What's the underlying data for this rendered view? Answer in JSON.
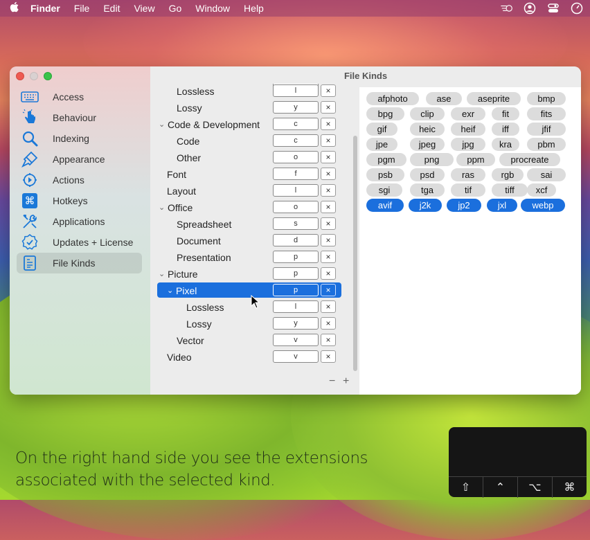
{
  "menubar": {
    "app_name": "Finder",
    "items": [
      "File",
      "Edit",
      "View",
      "Go",
      "Window",
      "Help"
    ]
  },
  "window": {
    "title": "File Kinds"
  },
  "sidebar": {
    "items": [
      {
        "label": "Access",
        "icon": "keyboard-icon"
      },
      {
        "label": "Behaviour",
        "icon": "hand-pointer-icon"
      },
      {
        "label": "Indexing",
        "icon": "magnifier-icon"
      },
      {
        "label": "Appearance",
        "icon": "brush-icon"
      },
      {
        "label": "Actions",
        "icon": "actions-icon"
      },
      {
        "label": "Hotkeys",
        "icon": "command-key-icon"
      },
      {
        "label": "Applications",
        "icon": "tools-icon"
      },
      {
        "label": "Updates + License",
        "icon": "badge-check-icon"
      },
      {
        "label": "File Kinds",
        "icon": "file-kinds-icon"
      }
    ],
    "selected": "File Kinds"
  },
  "tree": {
    "rows": [
      {
        "label": "Lossless",
        "key": "l",
        "chevron": ""
      },
      {
        "label": "Lossy",
        "key": "y",
        "chevron": ""
      },
      {
        "label": "Code & Development",
        "key": "c",
        "chevron": "⌄"
      },
      {
        "label": "Code",
        "key": "c",
        "chevron": ""
      },
      {
        "label": "Other",
        "key": "o",
        "chevron": ""
      },
      {
        "label": "Font",
        "key": "f",
        "chevron": ""
      },
      {
        "label": "Layout",
        "key": "l",
        "chevron": ""
      },
      {
        "label": "Office",
        "key": "o",
        "chevron": "⌄"
      },
      {
        "label": "Spreadsheet",
        "key": "s",
        "chevron": ""
      },
      {
        "label": "Document",
        "key": "d",
        "chevron": ""
      },
      {
        "label": "Presentation",
        "key": "p",
        "chevron": ""
      },
      {
        "label": "Picture",
        "key": "p",
        "chevron": "⌄"
      },
      {
        "label": "Pixel",
        "key": "p",
        "chevron": "⌄"
      },
      {
        "label": "Lossless",
        "key": "l",
        "chevron": ""
      },
      {
        "label": "Lossy",
        "key": "y",
        "chevron": ""
      },
      {
        "label": "Vector",
        "key": "v",
        "chevron": ""
      },
      {
        "label": "Video",
        "key": "v",
        "chevron": ""
      }
    ],
    "clear_symbol": "×",
    "selected_label": "Pixel",
    "minus": "−",
    "plus": "+"
  },
  "extensions": {
    "rows": [
      [
        "afphoto",
        "ase",
        "aseprite",
        "bmp"
      ],
      [
        "bpg",
        "clip",
        "exr",
        "fit",
        "fits"
      ],
      [
        "gif",
        "heic",
        "heif",
        "iff",
        "jfif"
      ],
      [
        "jpe",
        "jpeg",
        "jpg",
        "kra",
        "pbm"
      ],
      [
        "pgm",
        "png",
        "ppm",
        "procreate"
      ],
      [
        "psb",
        "psd",
        "ras",
        "rgb",
        "sai"
      ],
      [
        "sgi",
        "tga",
        "tif",
        "tiff",
        "xcf"
      ],
      [
        "avif",
        "j2k",
        "jp2",
        "jxl",
        "webp"
      ]
    ],
    "selected": [
      "avif",
      "j2k",
      "jp2",
      "jxl",
      "webp"
    ]
  },
  "caption": "On the right hand side you see the extensions associated with the selected kind.",
  "keys_overlay": {
    "keys": [
      "⇧",
      "⌃",
      "⌥",
      "⌘"
    ]
  }
}
